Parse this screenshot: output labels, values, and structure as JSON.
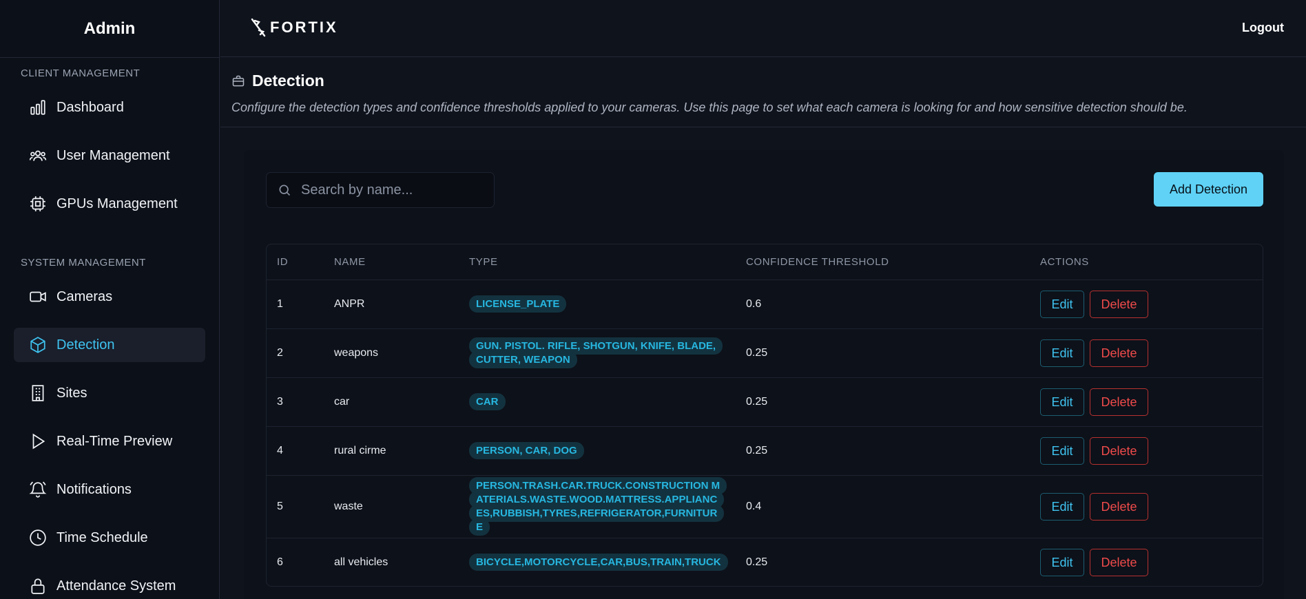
{
  "sidebar": {
    "brand": "Admin",
    "sections": [
      {
        "title": "CLIENT MANAGEMENT",
        "items": [
          {
            "label": "Dashboard",
            "icon": "bar-chart-icon"
          },
          {
            "label": "User Management",
            "icon": "users-icon"
          },
          {
            "label": "GPUs Management",
            "icon": "cpu-icon"
          }
        ]
      },
      {
        "title": "SYSTEM MANAGEMENT",
        "items": [
          {
            "label": "Cameras",
            "icon": "video-icon"
          },
          {
            "label": "Detection",
            "icon": "box-icon",
            "active": true
          },
          {
            "label": "Sites",
            "icon": "building-icon"
          },
          {
            "label": "Real-Time Preview",
            "icon": "play-icon"
          },
          {
            "label": "Notifications",
            "icon": "bell-icon"
          },
          {
            "label": "Time Schedule",
            "icon": "clock-icon"
          },
          {
            "label": "Attendance System",
            "icon": "lock-icon"
          }
        ]
      }
    ]
  },
  "header": {
    "logo_text": "FORTIX",
    "logout_label": "Logout"
  },
  "page": {
    "title": "Detection",
    "description": "Configure the detection types and confidence thresholds applied to your cameras. Use this page to set what each camera is looking for and how sensitive detection should be."
  },
  "toolbar": {
    "search_placeholder": "Search by name...",
    "search_value": "",
    "add_label": "Add Detection"
  },
  "table": {
    "columns": [
      "ID",
      "NAME",
      "TYPE",
      "CONFIDENCE THRESHOLD",
      "ACTIONS"
    ],
    "rows": [
      {
        "id": "1",
        "name": "ANPR",
        "type": "LICENSE_PLATE",
        "threshold": "0.6"
      },
      {
        "id": "2",
        "name": "weapons",
        "type": "GUN. PISTOL. RIFLE, SHOTGUN, KNIFE, BLADE, CUTTER, WEAPON",
        "threshold": "0.25"
      },
      {
        "id": "3",
        "name": "car",
        "type": "CAR",
        "threshold": "0.25"
      },
      {
        "id": "4",
        "name": "rural cirme",
        "type": "PERSON, CAR, DOG",
        "threshold": "0.25"
      },
      {
        "id": "5",
        "name": "waste",
        "type": "PERSON.TRASH.CAR.TRUCK.CONSTRUCTION MATERIALS.WASTE.WOOD.MATTRESS.APPLIANCES,RUBBISH,TYRES,REFRIGERATOR,FURNITURE",
        "threshold": "0.4"
      },
      {
        "id": "6",
        "name": "all vehicles",
        "type": "BICYCLE,MOTORCYCLE,CAR,BUS,TRAIN,TRUCK",
        "threshold": "0.25"
      }
    ],
    "edit_label": "Edit",
    "delete_label": "Delete"
  },
  "colors": {
    "accent": "#3fc3f0",
    "button_primary": "#5fd2f6",
    "danger": "#ef4b4b",
    "background": "#0f131c"
  }
}
